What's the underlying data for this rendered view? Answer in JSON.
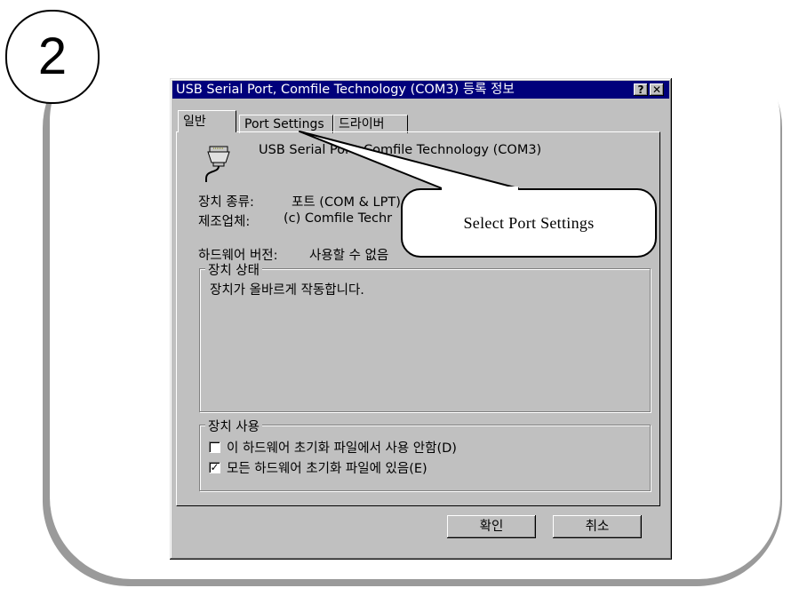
{
  "step": {
    "number": "2"
  },
  "dialog": {
    "title": "USB Serial Port, Comfile Technology (COM3) 등록 정보",
    "help_label": "?",
    "close_label": "✕",
    "tabs": [
      {
        "label": "일반"
      },
      {
        "label": "Port Settings"
      },
      {
        "label": "드라이버"
      }
    ],
    "device_name": "USB Serial Port, Comfile Technology (COM3)",
    "device_icon": "serial-port-connector-icon",
    "device_type_label": "장치 종류:",
    "device_type_value": "포트 (COM & LPT)",
    "manufacturer_label": "제조업체:",
    "manufacturer_value": "(c) Comfile Techr",
    "hardware_version_label": "하드웨어 버전:",
    "hardware_version_value": "사용할 수 없음",
    "device_status": {
      "legend": "장치 상태",
      "text": "장치가 올바르게 작동합니다."
    },
    "device_usage": {
      "legend": "장치 사용",
      "options": [
        {
          "label": "이 하드웨어 초기화 파일에서 사용 안함(D)",
          "checked": false
        },
        {
          "label": "모든 하드웨어 초기화 파일에 있음(E)",
          "checked": true
        }
      ]
    },
    "ok_label": "확인",
    "cancel_label": "취소"
  },
  "callout": {
    "text": "Select Port Settings"
  }
}
